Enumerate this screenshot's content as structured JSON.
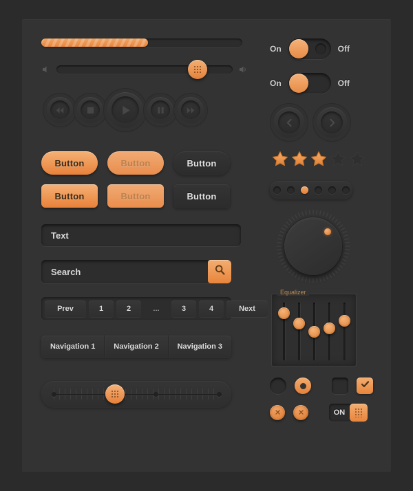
{
  "theme": {
    "background": "#2b2b2b",
    "panel": "#333333",
    "accent": "#e8853c",
    "accent_light": "#f5b175",
    "text": "#d8d8d8"
  },
  "progress": {
    "name": "progress-bar",
    "value_percent": 53,
    "striped": true
  },
  "volume_slider": {
    "name": "volume-slider",
    "value_percent": 80,
    "left_icon": "speaker-low-icon",
    "right_icon": "speaker-high-icon"
  },
  "media_controls": {
    "buttons": [
      {
        "name": "rewind-button",
        "icon": "rewind-icon",
        "size": "small"
      },
      {
        "name": "stop-button",
        "icon": "stop-icon",
        "size": "small"
      },
      {
        "name": "play-button",
        "icon": "play-icon",
        "size": "large"
      },
      {
        "name": "pause-button",
        "icon": "pause-icon",
        "size": "small"
      },
      {
        "name": "fast-forward-button",
        "icon": "fast-forward-icon",
        "size": "small"
      }
    ]
  },
  "buttons": {
    "rows": [
      {
        "shape": "pill",
        "items": [
          {
            "label": "Button",
            "style": "orange",
            "state": "default"
          },
          {
            "label": "Button",
            "style": "orange-dim",
            "state": "disabled"
          },
          {
            "label": "Button",
            "style": "dark",
            "state": "default"
          }
        ]
      },
      {
        "shape": "rect",
        "items": [
          {
            "label": "Button",
            "style": "orange",
            "state": "default"
          },
          {
            "label": "Button",
            "style": "orange-dim",
            "state": "disabled"
          },
          {
            "label": "Button",
            "style": "dark",
            "state": "default"
          }
        ]
      }
    ]
  },
  "text_field": {
    "name": "text-input",
    "value": "Text",
    "placeholder": "Text"
  },
  "search_field": {
    "name": "search-input",
    "value": "Search",
    "placeholder": "Search",
    "button_icon": "search-icon"
  },
  "pagination": {
    "prev_label": "Prev",
    "next_label": "Next",
    "pages": [
      "1",
      "2",
      "...",
      "3",
      "4"
    ]
  },
  "navigation": {
    "items": [
      "Navigation 1",
      "Navigation 2",
      "Navigation 3"
    ]
  },
  "ruler_slider": {
    "name": "ruler-slider",
    "value_percent": 37,
    "stop_positions": [
      0,
      62,
      100
    ]
  },
  "toggles": [
    {
      "on_label": "On",
      "off_label": "Off",
      "state": "on"
    },
    {
      "on_label": "On",
      "off_label": "Off",
      "state": "on"
    }
  ],
  "arrows": [
    {
      "name": "previous-arrow-button",
      "icon": "chevron-left-icon"
    },
    {
      "name": "next-arrow-button",
      "icon": "chevron-right-icon"
    }
  ],
  "rating": {
    "name": "star-rating",
    "value": 3,
    "max": 5
  },
  "dot_pagination": {
    "count": 6,
    "active_index": 2
  },
  "rotary_knob": {
    "name": "rotary-knob",
    "indicator_angle_deg": 45,
    "tick_count": 60
  },
  "equalizer": {
    "legend": "Equalizer",
    "channels": [
      {
        "name": "eq-band-1",
        "value_percent": 88
      },
      {
        "name": "eq-band-2",
        "value_percent": 62
      },
      {
        "name": "eq-band-3",
        "value_percent": 42
      },
      {
        "name": "eq-band-4",
        "value_percent": 50
      },
      {
        "name": "eq-band-5",
        "value_percent": 70
      }
    ]
  },
  "form_controls": {
    "radio_off": {
      "name": "radio-unchecked",
      "checked": false
    },
    "radio_on": {
      "name": "radio-checked",
      "checked": true
    },
    "checkbox_off": {
      "name": "checkbox-unchecked",
      "checked": false
    },
    "checkbox_on": {
      "name": "checkbox-checked",
      "checked": true,
      "icon": "check-icon"
    },
    "close_buttons": [
      {
        "name": "close-button-1",
        "icon": "close-icon"
      },
      {
        "name": "close-button-2",
        "icon": "close-icon"
      }
    ],
    "on_switch": {
      "name": "on-switch",
      "label": "ON",
      "state": "on"
    }
  }
}
